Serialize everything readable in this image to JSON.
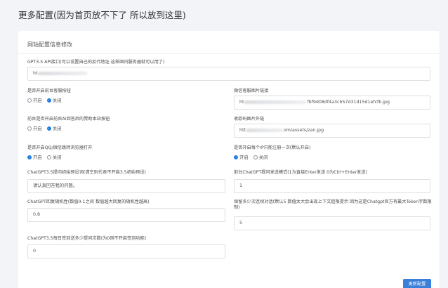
{
  "page": {
    "title": "更多配置(因为首页放不下了 所以放到这里)"
  },
  "card": {
    "title": "网站配置信息修改"
  },
  "radio_options": {
    "on": "开启",
    "off": "关闭"
  },
  "fields": {
    "api_proxy": {
      "label": "GPT3.5 API接口(可以设置自己的反代地址 这样国内服务器就可以用了)",
      "value_prefix": "ht"
    },
    "customer_service": {
      "label": "是否开启前台客服按钮",
      "selected": "off"
    },
    "wechat_qr": {
      "label": "微信客服图片链接",
      "value_prefix": "ht",
      "value_suffix": "fbf9d08df4a3cb57d31d15d1efcfb.jpg"
    },
    "sponsor_button": {
      "label": "前台是否开启前台Ai回答后的赞助本站按钮",
      "selected": "off"
    },
    "donation_qr": {
      "label": "收款码图片外链",
      "value_prefix": "htt",
      "value_suffix": "om/assets/zan.jpg"
    },
    "qq_wechat_jump": {
      "label": "是否开启QQ/微信跳转浏览器打开",
      "selected": "on"
    },
    "ip_register_once": {
      "label": "是否开启每个IP只能注册一次(默认开启)",
      "selected": "on"
    },
    "initial_prompt": {
      "label": "ChatGPT3.5提问初始预设词(清空则代表不开启3.5初始预设)",
      "value": "请认真回答我的问题。"
    },
    "send_mode": {
      "label": "前台ChatGPT提问发送模式(1为直接Enter发送 0为Ctrl+Enter发送)",
      "value": "1"
    },
    "randomness": {
      "label": "ChatGPT回复随机性(数值0-1之间 数值越大回复的随机性越高)",
      "value": "0.8"
    },
    "context_limit": {
      "label": "保留多少次连续对话(默认5 数值太大会出现上下文超限提示 因为这是Chatgpt官方有最大Token字数限制)",
      "value": "5"
    },
    "daily_checkin": {
      "label": "ChatGPT3.5每日签到送多少提问次数(为0则不开启签到功能)",
      "value": "0"
    }
  },
  "save_button": {
    "label": "更新配置"
  }
}
